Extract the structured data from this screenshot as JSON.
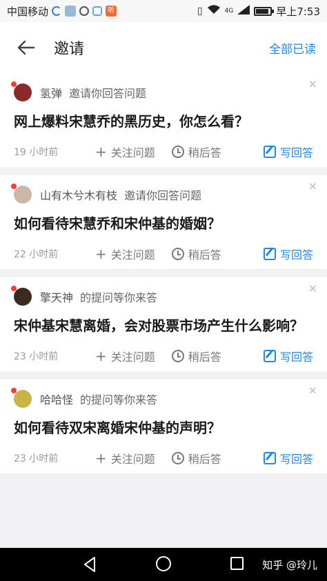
{
  "status_bar": {
    "carrier": "中国移动",
    "net_label": "4G",
    "time": "早上7:53"
  },
  "header": {
    "title": "邀请",
    "read_all": "全部已读"
  },
  "items": [
    {
      "user": "氢弹",
      "action": "邀请你回答问题",
      "question": "网上爆料宋慧乔的黑历史，你怎么看？",
      "time": "19 小时前",
      "avatar_color": "#8a2a2a"
    },
    {
      "user": "山有木兮木有枝",
      "action": "邀请你回答问题",
      "question": "如何看待宋慧乔和宋仲基的婚姻？",
      "time": "22 小时前",
      "avatar_color": "#c9b8a8"
    },
    {
      "user": "擎天神",
      "action": "的提问等你来答",
      "question": "宋仲基宋慧离婚，会对股票市场产生什么影响？",
      "time": "23 小时前",
      "avatar_color": "#3a2a20"
    },
    {
      "user": "哈哈怪",
      "action": "的提问等你来答",
      "question": "如何看待双宋离婚宋仲基的声明？",
      "time": "23 小时前",
      "avatar_color": "#c9b545"
    }
  ],
  "actions": {
    "follow": "关注问题",
    "later": "稍后答",
    "answer": "写回答",
    "close": "×"
  },
  "watermark": "知乎 @玲儿",
  "colors": {
    "accent": "#1e88e5",
    "unread_dot": "#ff3b30"
  }
}
